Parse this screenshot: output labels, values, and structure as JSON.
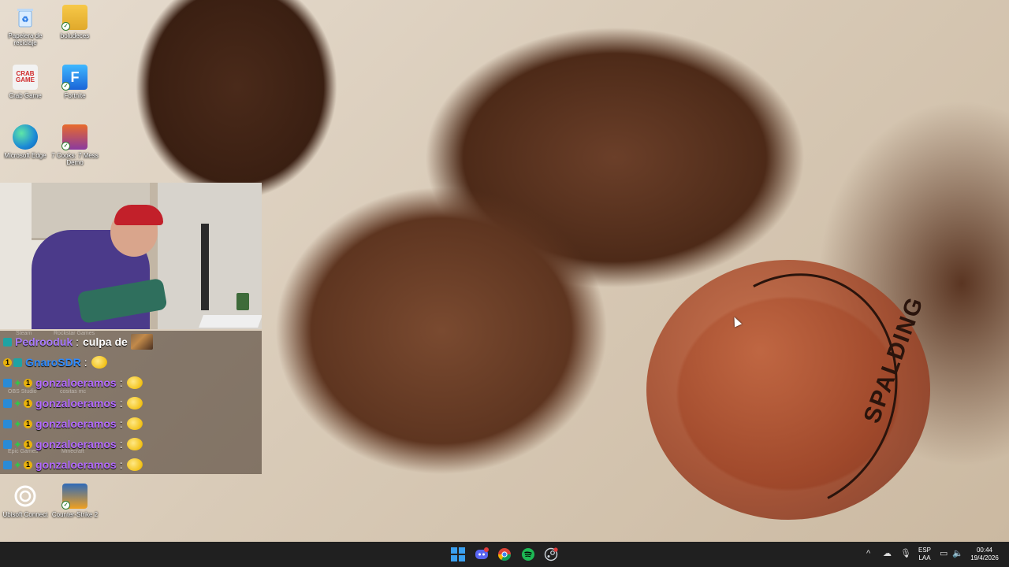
{
  "desktop": {
    "icons": [
      {
        "label": "Papelera de reciclaje",
        "icon": "recycle-bin-icon"
      },
      {
        "label": "boludeces",
        "icon": "folder-icon"
      },
      {
        "label": "Crab Game",
        "icon": "crab-game-icon"
      },
      {
        "label": "Fortnite",
        "icon": "fortnite-icon"
      },
      {
        "label": "Microsoft Edge",
        "icon": "edge-icon"
      },
      {
        "label": "7 Cooks: 7 Mess Demo",
        "icon": "game-icon"
      },
      {
        "label": "Ubisoft Connect",
        "icon": "ubisoft-icon"
      },
      {
        "label": "Counter-Strike 2",
        "icon": "counter-strike-icon"
      }
    ],
    "ghost_labels": [
      "Steam",
      "Rockstar Games",
      "OBS Studio",
      "cositas mc",
      "Epic Games",
      "Minecraft"
    ]
  },
  "chat": {
    "messages": [
      {
        "user": "Pedrooduk",
        "color": "#a97bff",
        "text": "culpa de",
        "badges": [
          "partner"
        ],
        "emote": "image"
      },
      {
        "user": "GnaroSDR",
        "color": "#2e8bff",
        "text": "",
        "badges": [
          "circle",
          "partner"
        ],
        "emote": "sunglasses"
      },
      {
        "user": "gonzaloeramos",
        "color": "#b36bff",
        "text": "",
        "badges": [
          "prime",
          "leaf",
          "circle"
        ],
        "emote": "sunglasses"
      },
      {
        "user": "gonzaloeramos",
        "color": "#b36bff",
        "text": "",
        "badges": [
          "prime",
          "leaf",
          "circle"
        ],
        "emote": "sunglasses"
      },
      {
        "user": "gonzaloeramos",
        "color": "#b36bff",
        "text": "",
        "badges": [
          "prime",
          "leaf",
          "circle"
        ],
        "emote": "sunglasses"
      },
      {
        "user": "gonzaloeramos",
        "color": "#b36bff",
        "text": "",
        "badges": [
          "prime",
          "leaf",
          "circle"
        ],
        "emote": "sunglasses"
      },
      {
        "user": "gonzaloeramos",
        "color": "#b36bff",
        "text": "",
        "badges": [
          "prime",
          "leaf",
          "circle"
        ],
        "emote": "sunglasses"
      }
    ],
    "colon": ":",
    "badge_number": "1"
  },
  "wallpaper": {
    "ball_text": "SPALDING"
  },
  "taskbar": {
    "apps": [
      "start-icon",
      "discord-icon",
      "chrome-icon",
      "spotify-icon",
      "steam-icon"
    ],
    "tray": {
      "lang_top": "ESP",
      "lang_bottom": "LAA",
      "time": "00:44",
      "date": "19/4/2026"
    }
  }
}
